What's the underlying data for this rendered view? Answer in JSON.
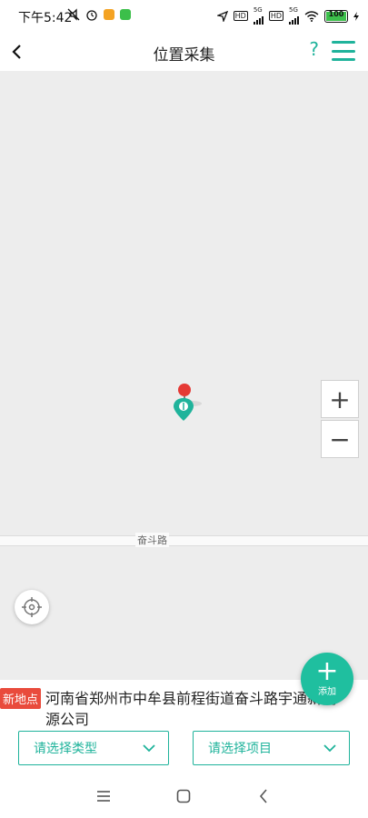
{
  "status_bar": {
    "time": "下午5:42",
    "network_1": "5G",
    "network_2": "5G",
    "battery": "100",
    "hd_1": "HD",
    "hd_2": "HD"
  },
  "header": {
    "title": "位置采集",
    "help": "?"
  },
  "map": {
    "road_name": "奋斗路",
    "zoom_in": "+",
    "zoom_out": "−"
  },
  "add_button": {
    "icon": "+",
    "label": "添加"
  },
  "location": {
    "badge": "新地点",
    "address": "河南省郑州市中牟县前程街道奋斗路宇通新能源公司"
  },
  "selects": {
    "type_placeholder": "请选择类型",
    "project_placeholder": "请选择项目"
  },
  "colors": {
    "accent": "#1fb39b",
    "badge": "#e94b3c",
    "map_bg": "#ededed"
  },
  "icons": {
    "back": "back-arrow-icon",
    "menu": "hamburger-menu-icon",
    "locate": "crosshair-icon",
    "nav_menu": "recents-icon",
    "nav_home": "home-icon",
    "nav_back": "back-icon"
  }
}
